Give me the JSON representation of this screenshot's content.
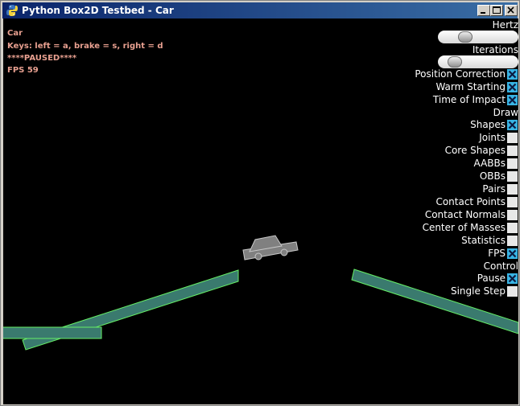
{
  "window": {
    "title": "Python Box2D Testbed - Car",
    "app_icon": "python-icon",
    "controls": [
      "minimize-icon",
      "maximize-icon",
      "close-icon"
    ]
  },
  "info": {
    "lines": [
      "Car",
      "Keys: left = a, brake = s, right = d",
      "****PAUSED****",
      "FPS 59"
    ],
    "color": "#e8a090"
  },
  "panel": {
    "hertz_label": "Hertz",
    "hertz_fraction": 0.3,
    "iterations_label": "Iterations",
    "iterations_fraction": 0.15,
    "options": [
      {
        "label": "Position Correction",
        "checked": true
      },
      {
        "label": "Warm Starting",
        "checked": true
      },
      {
        "label": "Time of Impact",
        "checked": true
      }
    ],
    "draw_heading": "Draw",
    "draw_options": [
      {
        "label": "Shapes",
        "checked": true
      },
      {
        "label": "Joints",
        "checked": false
      },
      {
        "label": "Core Shapes",
        "checked": false
      },
      {
        "label": "AABBs",
        "checked": false
      },
      {
        "label": "OBBs",
        "checked": false
      },
      {
        "label": "Pairs",
        "checked": false
      },
      {
        "label": "Contact Points",
        "checked": false
      },
      {
        "label": "Contact Normals",
        "checked": false
      },
      {
        "label": "Center of Masses",
        "checked": false
      },
      {
        "label": "Statistics",
        "checked": false
      },
      {
        "label": "FPS",
        "checked": true
      }
    ],
    "control_heading": "Control",
    "control_options": [
      {
        "label": "Pause",
        "checked": true
      },
      {
        "label": "Single Step",
        "checked": false
      }
    ]
  },
  "colors": {
    "ground_fill": "#3a7a6e",
    "ground_outline": "#66ee66",
    "car_fill": "#808080",
    "checkbox_on": "#38b4e4",
    "checkbox_off": "#e8e8e8"
  }
}
